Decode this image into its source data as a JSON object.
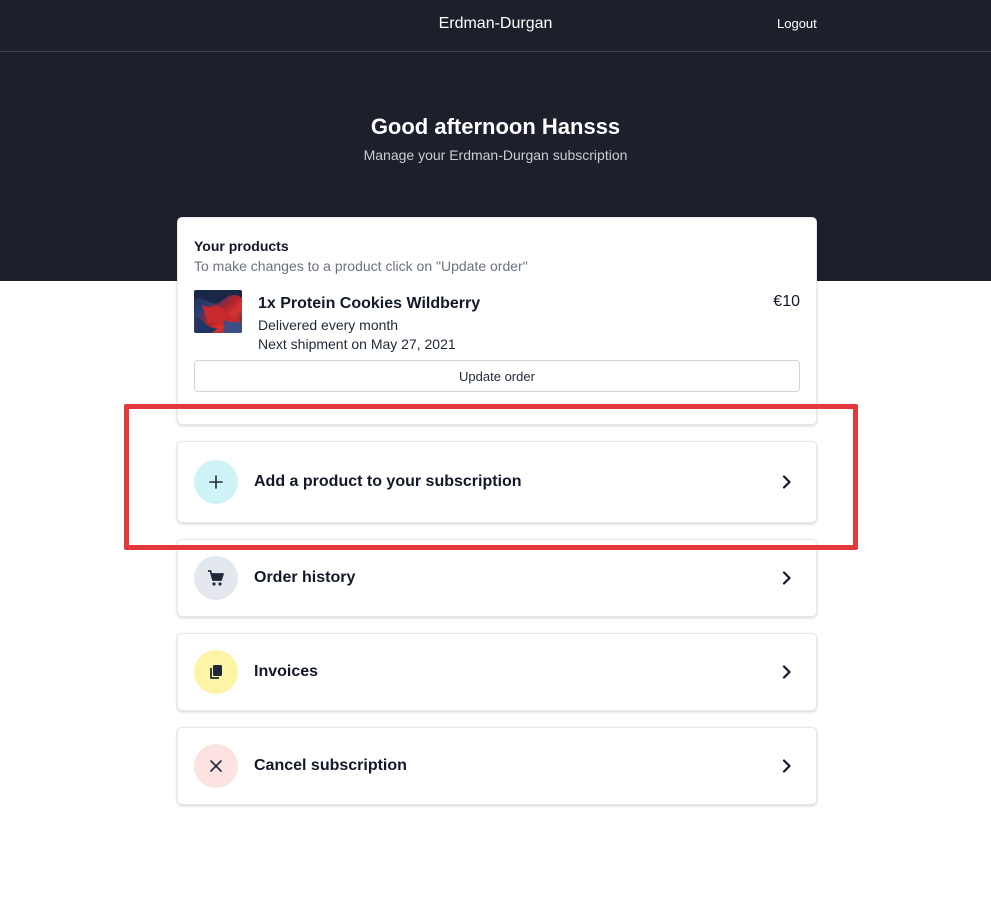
{
  "header": {
    "brand": "Erdman-Durgan",
    "logout_label": "Logout"
  },
  "hero": {
    "greeting": "Good afternoon Hansss",
    "subtitle": "Manage your Erdman-Durgan subscription"
  },
  "products": {
    "title": "Your products",
    "hint": "To make changes to a product click on \"Update order\"",
    "items": [
      {
        "name": "1x Protein Cookies Wildberry",
        "frequency": "Delivered every month",
        "next_shipment": "Next shipment on May 27, 2021",
        "price": "€10",
        "thumbnail_icon": "product-image"
      }
    ],
    "update_label": "Update order"
  },
  "actions": [
    {
      "label": "Add a product to your subscription",
      "icon": "plus-icon",
      "icon_bg": "#cff4f7",
      "icon_color": "#1f2937"
    },
    {
      "label": "Order history",
      "icon": "cart-icon",
      "icon_bg": "#e3e8ef",
      "icon_color": "#1f2937"
    },
    {
      "label": "Invoices",
      "icon": "documents-icon",
      "icon_bg": "#fdf4a6",
      "icon_color": "#1f2937"
    },
    {
      "label": "Cancel subscription",
      "icon": "close-icon",
      "icon_bg": "#fde2e2",
      "icon_color": "#1f2937"
    }
  ],
  "colors": {
    "hero_bg": "#1d202b",
    "highlight": "#e5383b"
  }
}
